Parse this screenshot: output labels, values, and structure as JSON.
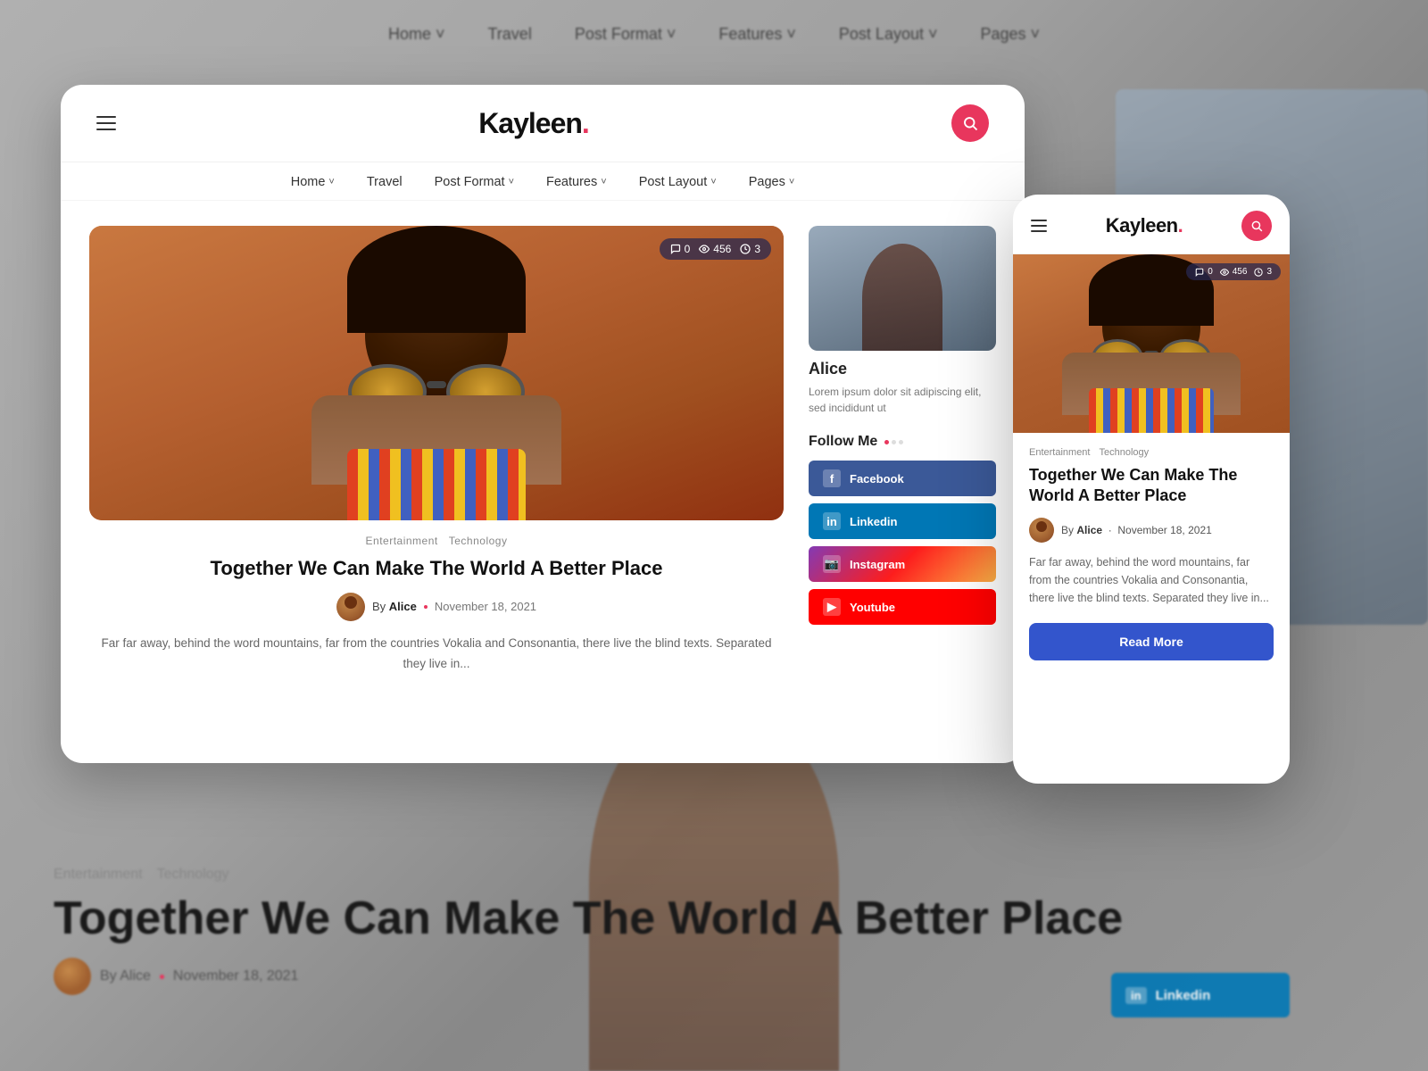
{
  "background": {
    "nav_items": [
      "Home ˅",
      "Travel",
      "Post Format ˅",
      "Features ˅",
      "Post Layout ˅",
      "Pages ˅"
    ]
  },
  "desktop_card": {
    "logo": "Kayleen",
    "logo_dot": ".",
    "nav": {
      "items": [
        {
          "label": "Home",
          "has_dropdown": true
        },
        {
          "label": "Travel",
          "has_dropdown": false
        },
        {
          "label": "Post Format",
          "has_dropdown": true
        },
        {
          "label": "Features",
          "has_dropdown": true
        },
        {
          "label": "Post Layout",
          "has_dropdown": true
        },
        {
          "label": "Pages",
          "has_dropdown": true
        }
      ]
    },
    "article": {
      "stats": {
        "comments": "0",
        "views": "456",
        "likes": "3"
      },
      "categories": [
        "Entertainment",
        "Technology"
      ],
      "title": "Together We Can Make The World A Better Place",
      "author": {
        "by": "By",
        "name": "Alice",
        "date": "November 18, 2021"
      },
      "excerpt": "Far far away, behind the word mountains, far from the countries Vokalia and Consonantia, there live the blind texts. Separated they live in..."
    },
    "sidebar": {
      "alice_name": "Alice",
      "bio": "Lorem ipsum dolor sit adipiscing elit, sed incididunt ut",
      "follow_me": "Follow Me",
      "social_links": [
        {
          "platform": "Facebook",
          "icon": "f"
        },
        {
          "platform": "Linkedin",
          "icon": "in"
        },
        {
          "platform": "Instagram",
          "icon": "📷"
        },
        {
          "platform": "Youtube",
          "icon": "▶"
        }
      ]
    }
  },
  "mobile_card": {
    "logo": "Kayleen",
    "logo_dot": ".",
    "article": {
      "stats": {
        "comments": "0",
        "views": "456",
        "likes": "3"
      },
      "categories": [
        "Entertainment",
        "Technology"
      ],
      "title": "Together We Can Make The World A Better Place",
      "author": {
        "by": "By",
        "name": "Alice",
        "date": "November 18, 2021"
      },
      "excerpt": "Far far away, behind the word mountains, far from the countries Vokalia and Consonantia, there live the blind texts. Separated they live in...",
      "read_more": "Read More"
    }
  },
  "background_content": {
    "categories": [
      "Entertainment",
      "Technology"
    ],
    "title": "Together We Can Make The World A Better Place",
    "author_by": "By Alice",
    "date": "November 18, 2021",
    "linkedin_label": "Linkedin"
  },
  "colors": {
    "accent": "#e8365d",
    "facebook": "#3b5998",
    "linkedin": "#0077b5",
    "instagram_start": "#833ab4",
    "youtube": "#ff0000",
    "read_more_btn": "#3355cc"
  }
}
